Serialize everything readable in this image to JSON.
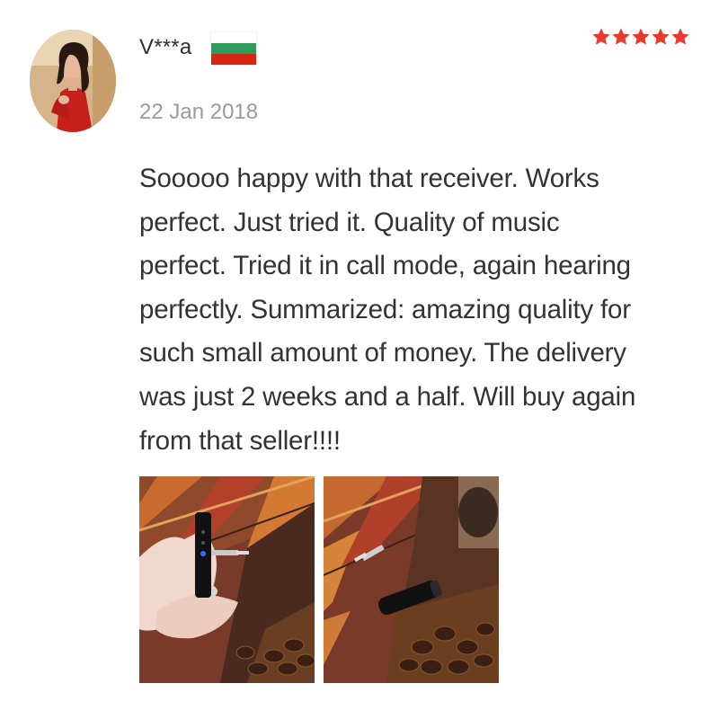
{
  "review": {
    "author": "V***a",
    "country_flag": "bulgaria-flag",
    "flag_colors": [
      "#ffffff",
      "#2e9a5b",
      "#d62612"
    ],
    "date": "22 Jan 2018",
    "rating": 5,
    "rating_max": 5,
    "star_color": "#e8392f",
    "text": "Sooooo happy with that receiver. Works\nperfect. Just tried it. Quality of music\nperfect. Tried it in call mode, again hearing\nperfectly. Summarized: amazing quality for\nsuch small amount of money. The delivery\nwas just 2 weeks and a half. Will buy again\nfrom that seller!!!!"
  },
  "photos": [
    {
      "icon": "review-photo-receiver-in-hand"
    },
    {
      "icon": "review-photo-receiver-on-table"
    }
  ]
}
